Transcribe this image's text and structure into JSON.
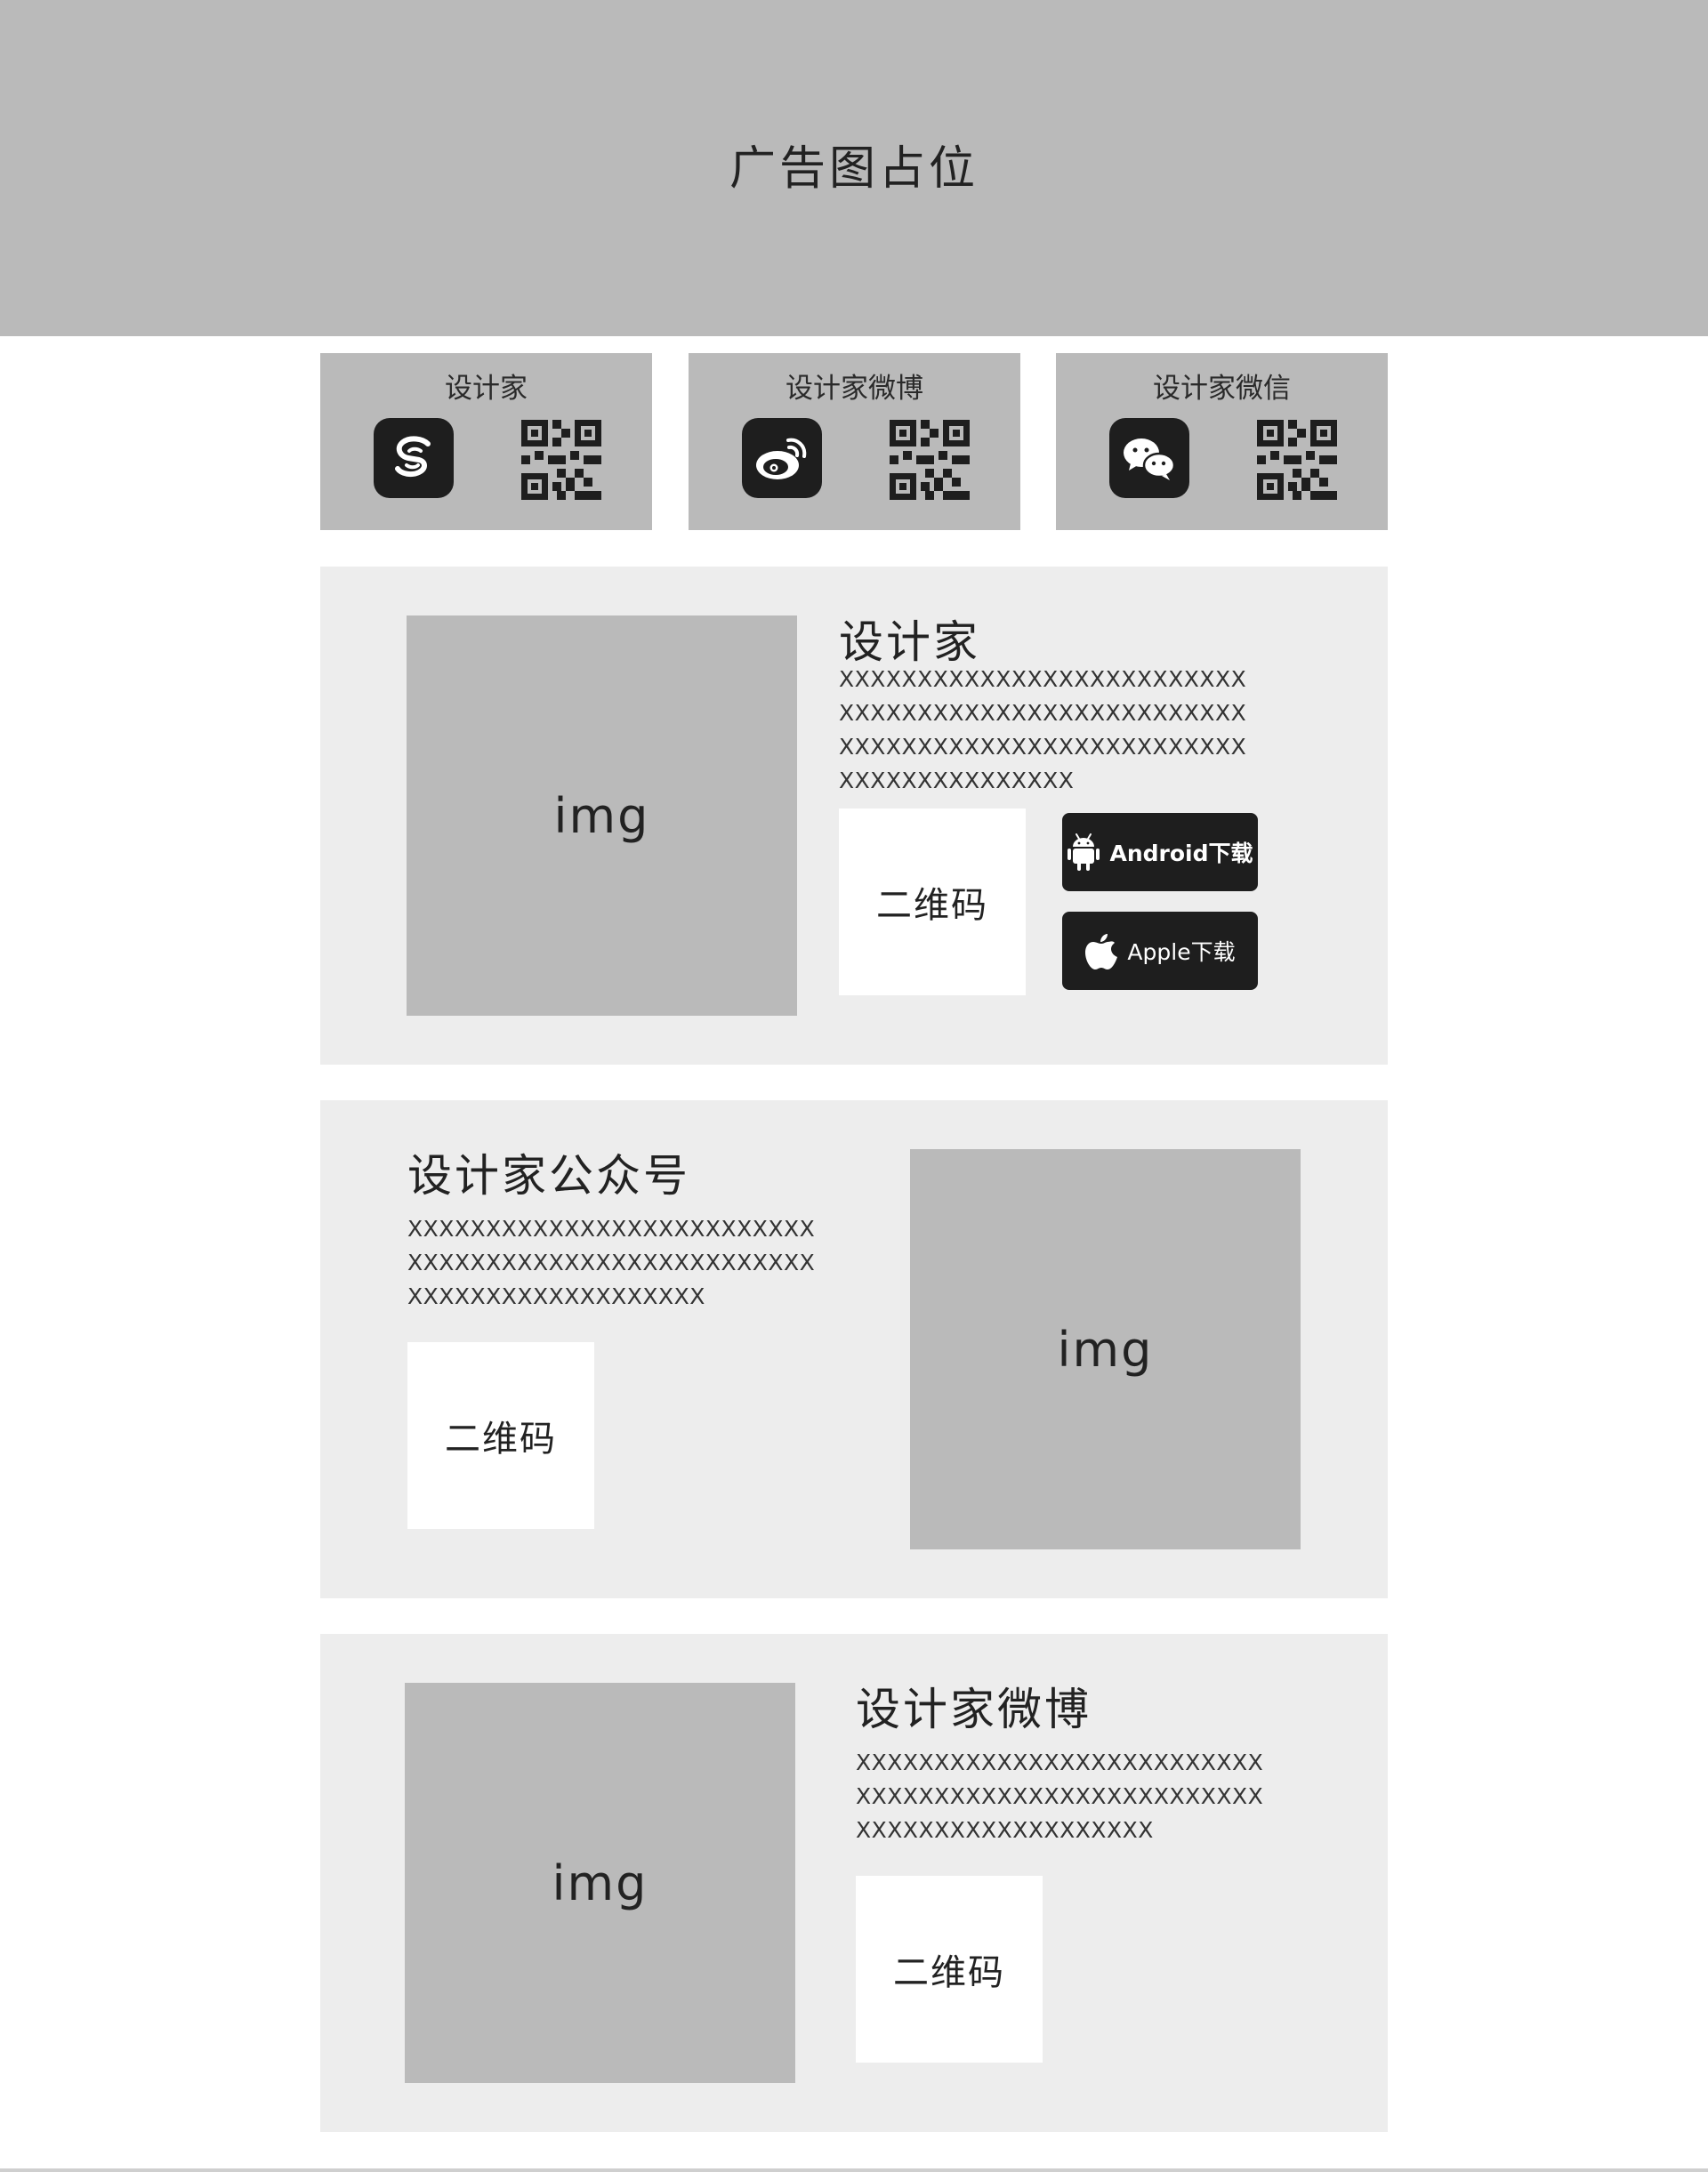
{
  "banner": {
    "text": "广告图占位"
  },
  "social_cards": [
    {
      "title": "设计家",
      "icon": "designer-logo-icon"
    },
    {
      "title": "设计家微博",
      "icon": "weibo-icon"
    },
    {
      "title": "设计家微信",
      "icon": "wechat-icon"
    }
  ],
  "sections": [
    {
      "title": "设计家",
      "description": "XXXXXXXXXXXXXXXXXXXXXXXXXXXXXXXXXXXXXXXXXXXXXXXXXXXXXXXXXXXXXXXXXXXXXXXXXXXXXXXXXXXXXXXXXXXXX",
      "img_label": "img",
      "qr_label": "二维码",
      "android_label": "Android下载",
      "apple_label": "Apple下载"
    },
    {
      "title": "设计家公众号",
      "description": "XXXXXXXXXXXXXXXXXXXXXXXXXXXXXXXXXXXXXXXXXXXXXXXXXXXXXXXXXXXXXXXXXXXXXXX",
      "img_label": "img",
      "qr_label": "二维码"
    },
    {
      "title": "设计家微博",
      "description": "XXXXXXXXXXXXXXXXXXXXXXXXXXXXXXXXXXXXXXXXXXXXXXXXXXXXXXXXXXXXXXXXXXXXXXX",
      "img_label": "img",
      "qr_label": "二维码"
    }
  ],
  "colors": {
    "banner_bg": "#bababa",
    "section_bg": "#ededed",
    "icon_bg": "#1e1e1e",
    "qr_bg": "#ffffff"
  }
}
